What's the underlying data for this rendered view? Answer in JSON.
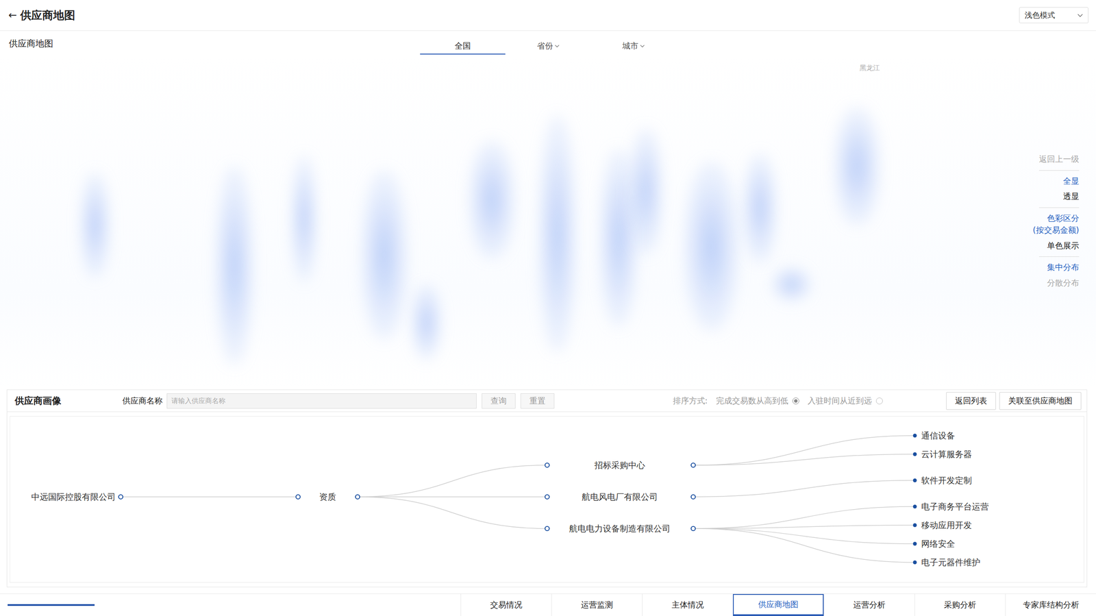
{
  "header": {
    "back": "←",
    "title": "供应商地图",
    "theme_select": {
      "value": "浅色模式"
    }
  },
  "map_panel": {
    "title": "供应商地图",
    "tabs": [
      {
        "label": "全国",
        "selected": true,
        "dropdown": false
      },
      {
        "label": "省份",
        "selected": false,
        "dropdown": true
      },
      {
        "label": "城市",
        "selected": false,
        "dropdown": true
      }
    ],
    "region_labels": [
      "黑龙江"
    ],
    "control_groups": [
      [
        {
          "label": "返回上一级",
          "selected": false,
          "disabled": true
        }
      ],
      [
        {
          "label": "全显",
          "selected": true,
          "disabled": false
        },
        {
          "label": "透显",
          "selected": false,
          "disabled": false
        }
      ],
      [
        {
          "label": "色彩区分",
          "sublabel": "(按交易金额)",
          "selected": true,
          "disabled": false
        },
        {
          "label": "单色展示",
          "sublabel": "",
          "selected": false,
          "disabled": false
        }
      ],
      [
        {
          "label": "集中分布",
          "selected": true,
          "disabled": false
        },
        {
          "label": "分散分布",
          "selected": false,
          "disabled": true
        }
      ]
    ]
  },
  "portrait_panel": {
    "title": "供应商画像",
    "search": {
      "label": "供应商名称",
      "placeholder": "请输入供应商名称",
      "buttons": [
        "查询",
        "重置"
      ]
    },
    "sort": {
      "label": "排序方式:",
      "options": [
        {
          "label": "完成交易数从高到低",
          "selected": true
        },
        {
          "label": "入驻时间从近到远",
          "selected": false
        }
      ]
    },
    "actions": [
      "返回列表",
      "关联至供应商地图"
    ],
    "tree": {
      "root": "中远国际控股有限公司",
      "category": "资质",
      "children": [
        {
          "name": "招标采购中心",
          "children": [
            "通信设备",
            "云计算服务器"
          ]
        },
        {
          "name": "航电风电厂有限公司",
          "children": [
            "软件开发定制"
          ]
        },
        {
          "name": "航电电力设备制造有限公司",
          "children": [
            "电子商务平台运营",
            "移动应用开发",
            "网络安全",
            "电子元器件维护"
          ]
        }
      ]
    }
  },
  "bottom_nav": [
    {
      "label": "交易情况",
      "selected": false
    },
    {
      "label": "运营监测",
      "selected": false
    },
    {
      "label": "主体情况",
      "selected": false
    },
    {
      "label": "供应商地图",
      "selected": true
    },
    {
      "label": "运营分析",
      "selected": false
    },
    {
      "label": "采购分析",
      "selected": false
    },
    {
      "label": "专家库结构分析",
      "selected": false
    }
  ]
}
